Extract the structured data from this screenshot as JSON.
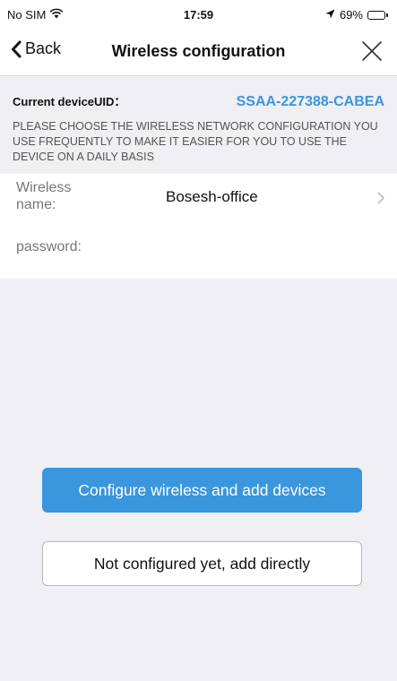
{
  "status_bar": {
    "carrier": "No SIM",
    "wifi_icon": "wifi-icon",
    "time": "17:59",
    "location_icon": "location-arrow-icon",
    "battery_percent": "69%",
    "battery_level": 0.69
  },
  "nav": {
    "back_label": "Back",
    "title": "Wireless configuration",
    "close_icon": "close-icon"
  },
  "device": {
    "uid_label": "Current deviceUID：",
    "uid_value": "SSAA-227388-CABEA",
    "instruction": "PLEASE CHOOSE THE WIRELESS NETWORK CONFIGURATION YOU USE FREQUENTLY TO MAKE IT EASIER FOR YOU TO USE THE DEVICE ON A DAILY BASIS"
  },
  "form": {
    "ssid_label": "Wireless name:",
    "ssid_value": "Bosesh-office",
    "password_label": "password:",
    "password_value": ""
  },
  "actions": {
    "configure_label": "Configure wireless and add devices",
    "skip_label": "Not configured yet, add directly"
  },
  "colors": {
    "accent": "#3a96dd",
    "background": "#efeff4"
  }
}
